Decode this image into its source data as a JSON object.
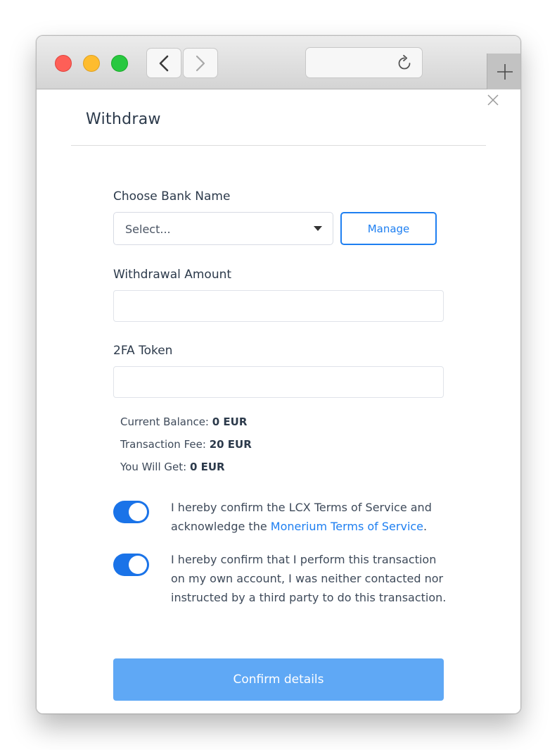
{
  "browser": {
    "back_icon": "chevron-left-icon",
    "forward_icon": "chevron-right-icon",
    "reload_icon": "reload-icon",
    "new_tab_icon": "plus-icon"
  },
  "modal": {
    "title": "Withdraw",
    "close_icon": "close-icon",
    "bank": {
      "label": "Choose Bank Name",
      "select_value": "Select...",
      "manage_label": "Manage"
    },
    "amount": {
      "label": "Withdrawal Amount",
      "value": ""
    },
    "token": {
      "label": "2FA Token",
      "value": ""
    },
    "summary": {
      "balance_label": "Current Balance:",
      "balance_value": "0 EUR",
      "fee_label": "Transaction Fee:",
      "fee_value": "20 EUR",
      "get_label": "You Will Get:",
      "get_value": "0 EUR"
    },
    "consents": [
      {
        "text_before": "I hereby confirm the LCX Terms of Service and acknowledge the ",
        "link": "Monerium Terms of Service",
        "text_after": ".",
        "enabled": true
      },
      {
        "text": "I hereby confirm that I perform this transaction on my own account, I was neither contacted nor instructed by a third party to do this transaction.",
        "enabled": true
      }
    ],
    "confirm_label": "Confirm details"
  },
  "colors": {
    "accent": "#1e7ff1",
    "toggle_on": "#1a73e8",
    "confirm_button": "#5fa8f5"
  }
}
